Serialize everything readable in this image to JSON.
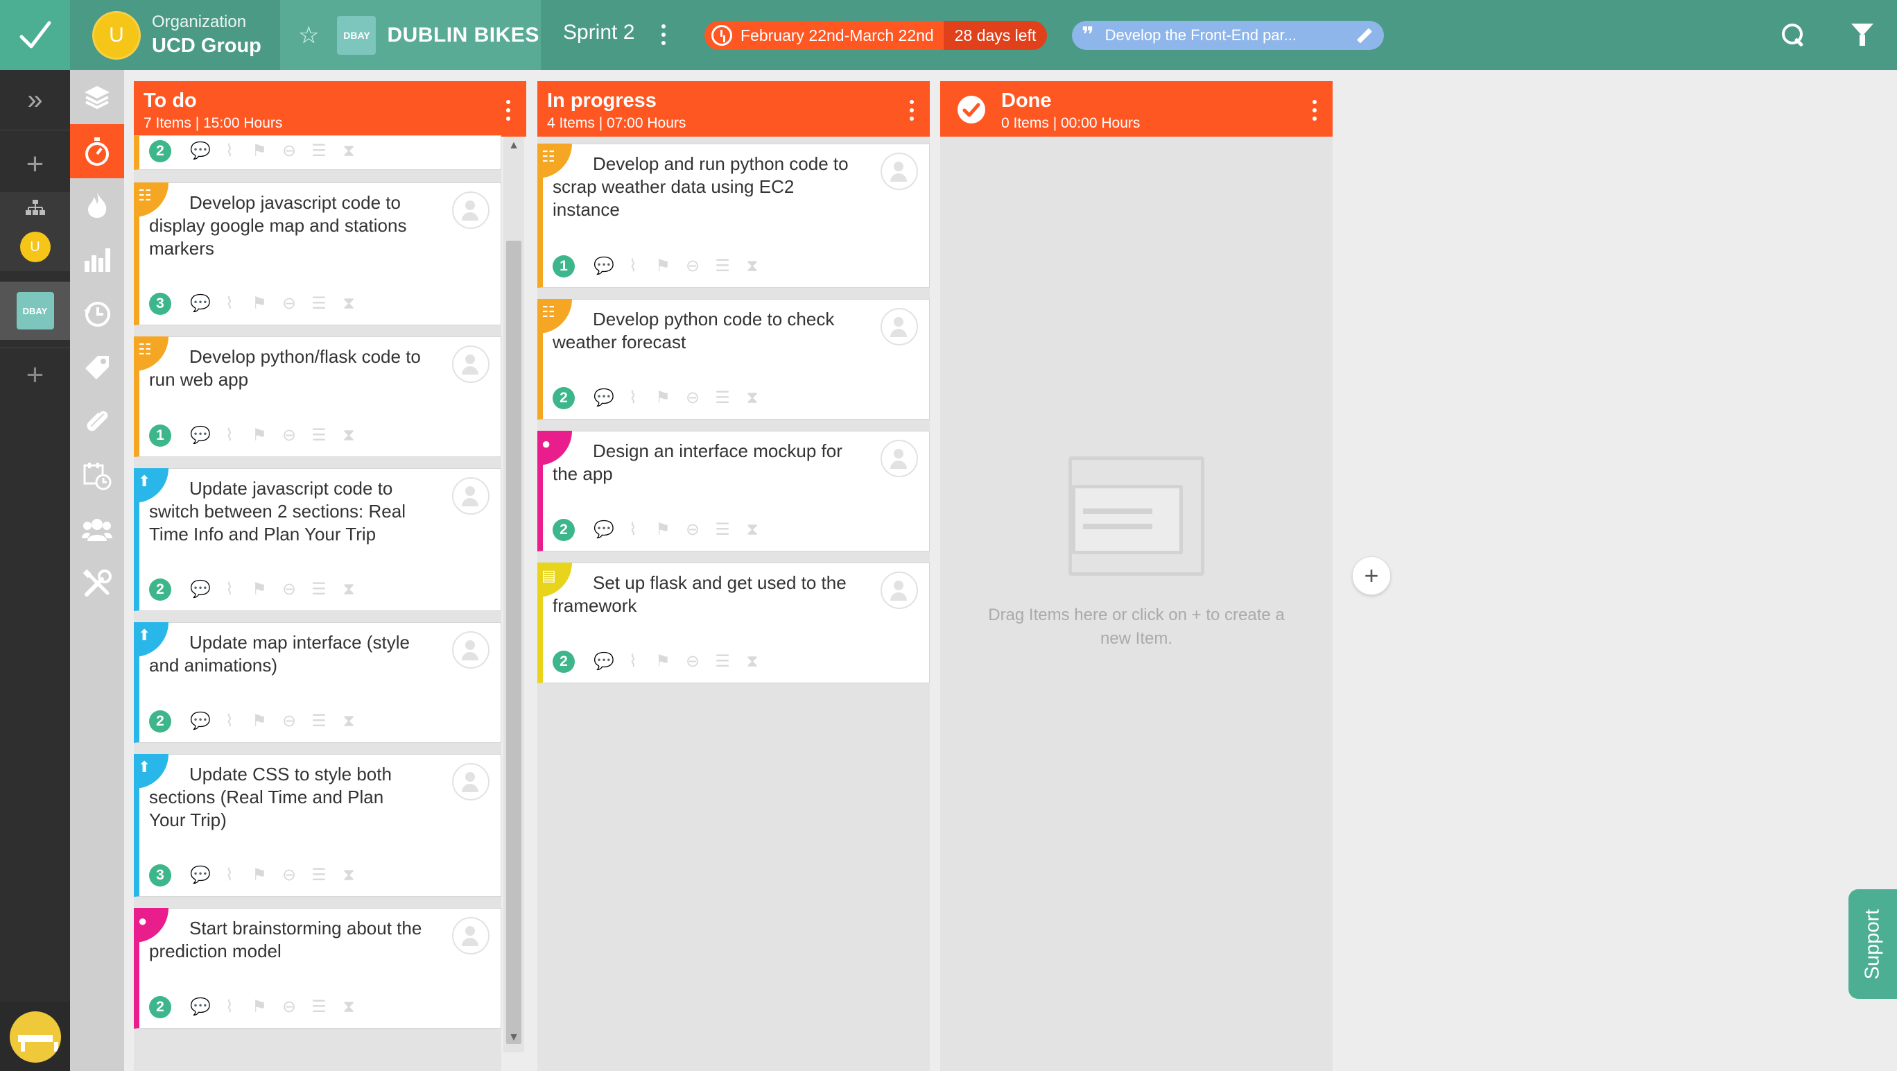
{
  "topbar": {
    "org_label": "Organization",
    "org_name": "UCD Group",
    "org_avatar_letter": "U",
    "project_badge": "DBAY",
    "project_name": "DUBLIN BIKES",
    "sprint_name": "Sprint 2",
    "sprint_dates": "February 22nd-March 22nd",
    "days_left": "28 days left",
    "sprint_goal": "Develop the Front-End par..."
  },
  "rail": {
    "avatar_letter": "U",
    "project_badge": "DBAY"
  },
  "colors": {
    "accent": "#ff5722",
    "teal": "#4a9a85",
    "orange_tag": "#f5a623",
    "blue_tag": "#29b6e8",
    "pink_tag": "#e91e8c",
    "yellow_tag": "#e8d41a",
    "badge_green": "#3cb68a"
  },
  "columns": [
    {
      "title": "To do",
      "summary": "7 Items | 15:00 Hours",
      "partial_badge": "2",
      "cards": [
        {
          "title": "Develop javascript code to display google map and stations markers",
          "count": "3",
          "type": "task-icon"
        },
        {
          "title": "Develop python/flask code to run web app",
          "count": "1",
          "type": "task-icon"
        },
        {
          "title": "Update javascript code to switch between 2 sections: Real Time Info and Plan Your Trip",
          "count": "2",
          "type": "improvement-icon"
        },
        {
          "title": "Update map interface (style and animations)",
          "count": "2",
          "type": "improvement-icon"
        },
        {
          "title": "Update CSS to style both sections (Real Time and Plan Your Trip)",
          "count": "3",
          "type": "improvement-icon"
        },
        {
          "title": "Start brainstorming about the prediction model",
          "count": "2",
          "type": "idea-icon"
        }
      ]
    },
    {
      "title": "In progress",
      "summary": "4 Items | 07:00 Hours",
      "cards": [
        {
          "title": "Develop and run python code to scrap weather data using EC2 instance",
          "count": "1",
          "type": "task-icon"
        },
        {
          "title": "Develop python code to check weather forecast",
          "count": "2",
          "type": "task-icon"
        },
        {
          "title": "Design an interface mockup for the app",
          "count": "2",
          "type": "idea-icon"
        },
        {
          "title": "Set up flask and get used to the framework",
          "count": "2",
          "type": "note-icon"
        }
      ]
    },
    {
      "title": "Done",
      "summary": "0 Items | 00:00 Hours",
      "empty_text": "Drag Items here or click on + to create a new Item."
    }
  ],
  "support_label": "Support"
}
